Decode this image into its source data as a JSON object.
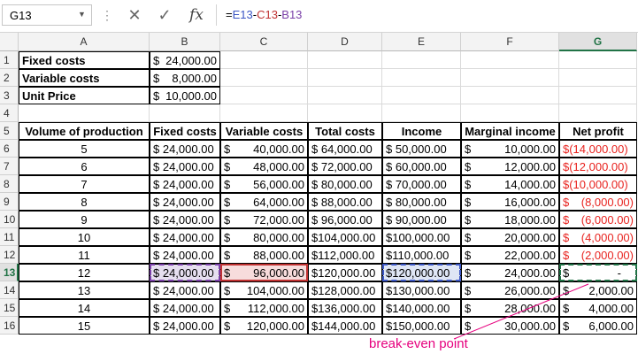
{
  "formula_bar": {
    "name_box": "G13",
    "formula_parts": [
      {
        "text": "=",
        "color": "#000000"
      },
      {
        "text": "E13",
        "color": "#3b56c4"
      },
      {
        "text": "-",
        "color": "#000000"
      },
      {
        "text": "C13",
        "color": "#c03131"
      },
      {
        "text": "-",
        "color": "#000000"
      },
      {
        "text": "B13",
        "color": "#7a3fa8"
      }
    ],
    "fx": "fx"
  },
  "columns": [
    "A",
    "B",
    "C",
    "D",
    "E",
    "F",
    "G"
  ],
  "selected_column": "G",
  "rows": [
    "1",
    "2",
    "3",
    "4",
    "5",
    "6",
    "7",
    "8",
    "9",
    "10",
    "11",
    "12",
    "13",
    "14",
    "15",
    "16"
  ],
  "selected_row": "13",
  "inputs": [
    {
      "label": "Fixed costs",
      "symbol": "$",
      "value": "24,000.00"
    },
    {
      "label": "Variable costs",
      "symbol": "$",
      "value": "8,000.00"
    },
    {
      "label": "Unit Price",
      "symbol": "$",
      "value": "10,000.00"
    }
  ],
  "table_headers": [
    "Volume of production",
    "Fixed costs",
    "Variable costs",
    "Total costs",
    "Income",
    "Marginal income",
    "Net profit"
  ],
  "table_rows": [
    [
      "5",
      "$ 24,000.00",
      [
        "$",
        "40,000.00"
      ],
      "$ 64,000.00",
      "$ 50,000.00",
      [
        "$",
        "10,000.00"
      ],
      [
        "$(14,000.00)",
        "",
        true
      ]
    ],
    [
      "6",
      "$ 24,000.00",
      [
        "$",
        "48,000.00"
      ],
      "$ 72,000.00",
      "$ 60,000.00",
      [
        "$",
        "12,000.00"
      ],
      [
        "$(12,000.00)",
        "",
        true
      ]
    ],
    [
      "7",
      "$ 24,000.00",
      [
        "$",
        "56,000.00"
      ],
      "$ 80,000.00",
      "$ 70,000.00",
      [
        "$",
        "14,000.00"
      ],
      [
        "$(10,000.00)",
        "",
        true
      ]
    ],
    [
      "8",
      "$ 24,000.00",
      [
        "$",
        "64,000.00"
      ],
      "$ 88,000.00",
      "$ 80,000.00",
      [
        "$",
        "16,000.00"
      ],
      [
        "$",
        "(8,000.00)",
        true
      ]
    ],
    [
      "9",
      "$ 24,000.00",
      [
        "$",
        "72,000.00"
      ],
      "$ 96,000.00",
      "$ 90,000.00",
      [
        "$",
        "18,000.00"
      ],
      [
        "$",
        "(6,000.00)",
        true
      ]
    ],
    [
      "10",
      "$ 24,000.00",
      [
        "$",
        "80,000.00"
      ],
      "$104,000.00",
      "$100,000.00",
      [
        "$",
        "20,000.00"
      ],
      [
        "$",
        "(4,000.00)",
        true
      ]
    ],
    [
      "11",
      "$ 24,000.00",
      [
        "$",
        "88,000.00"
      ],
      "$112,000.00",
      "$110,000.00",
      [
        "$",
        "22,000.00"
      ],
      [
        "$",
        "(2,000.00)",
        true
      ]
    ],
    [
      "12",
      "$ 24,000.00",
      [
        "$",
        "96,000.00"
      ],
      "$120,000.00",
      "$120,000.00",
      [
        "$",
        "24,000.00"
      ],
      [
        "$",
        "-",
        false
      ]
    ],
    [
      "13",
      "$ 24,000.00",
      [
        "$",
        "104,000.00"
      ],
      "$128,000.00",
      "$130,000.00",
      [
        "$",
        "26,000.00"
      ],
      [
        "$",
        "2,000.00",
        false
      ]
    ],
    [
      "14",
      "$ 24,000.00",
      [
        "$",
        "112,000.00"
      ],
      "$136,000.00",
      "$140,000.00",
      [
        "$",
        "28,000.00"
      ],
      [
        "$",
        "4,000.00",
        false
      ]
    ],
    [
      "15",
      "$ 24,000.00",
      [
        "$",
        "120,000.00"
      ],
      "$144,000.00",
      "$150,000.00",
      [
        "$",
        "30,000.00"
      ],
      [
        "$",
        "6,000.00",
        false
      ]
    ]
  ],
  "annotation": "break-even point",
  "colors": {
    "negative": "#e8231f",
    "annotation": "#e6007e",
    "selection": "#217346",
    "ref_fixed": "#7a3fa8",
    "ref_variable": "#c03131",
    "ref_income": "#3b56c4"
  }
}
